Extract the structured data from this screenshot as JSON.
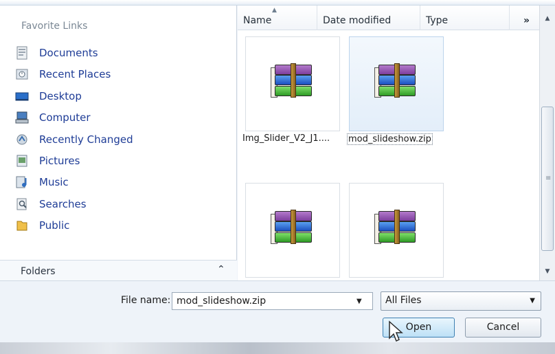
{
  "nav": {
    "header": "Favorite Links",
    "items": [
      {
        "label": "Documents",
        "icon": "documents-icon"
      },
      {
        "label": "Recent Places",
        "icon": "recent-places-icon"
      },
      {
        "label": "Desktop",
        "icon": "desktop-icon"
      },
      {
        "label": "Computer",
        "icon": "computer-icon"
      },
      {
        "label": "Recently Changed",
        "icon": "recently-changed-icon"
      },
      {
        "label": "Pictures",
        "icon": "pictures-icon"
      },
      {
        "label": "Music",
        "icon": "music-icon"
      },
      {
        "label": "Searches",
        "icon": "searches-icon"
      },
      {
        "label": "Public",
        "icon": "public-icon"
      }
    ],
    "folders_label": "Folders",
    "folders_chevron": "⌃"
  },
  "columns": {
    "name": "Name",
    "date_modified": "Date modified",
    "type": "Type",
    "more": "»"
  },
  "files": [
    {
      "label": "Img_Slider_V2_J1....",
      "icon": "winrar-archive-icon",
      "selected": false
    },
    {
      "label": "mod_slideshow.zip",
      "icon": "winrar-archive-icon",
      "selected": true
    },
    {
      "label": "",
      "icon": "winrar-archive-icon",
      "selected": false
    },
    {
      "label": "",
      "icon": "winrar-archive-icon",
      "selected": false
    }
  ],
  "file_name": {
    "label": "File name:",
    "value": "mod_slideshow.zip"
  },
  "filter": {
    "value": "All Files"
  },
  "buttons": {
    "open": "Open",
    "cancel": "Cancel"
  },
  "colors": {
    "link": "#1e3c96",
    "selected_tile": "#e3eef9",
    "open_button": "#bde0f6"
  }
}
